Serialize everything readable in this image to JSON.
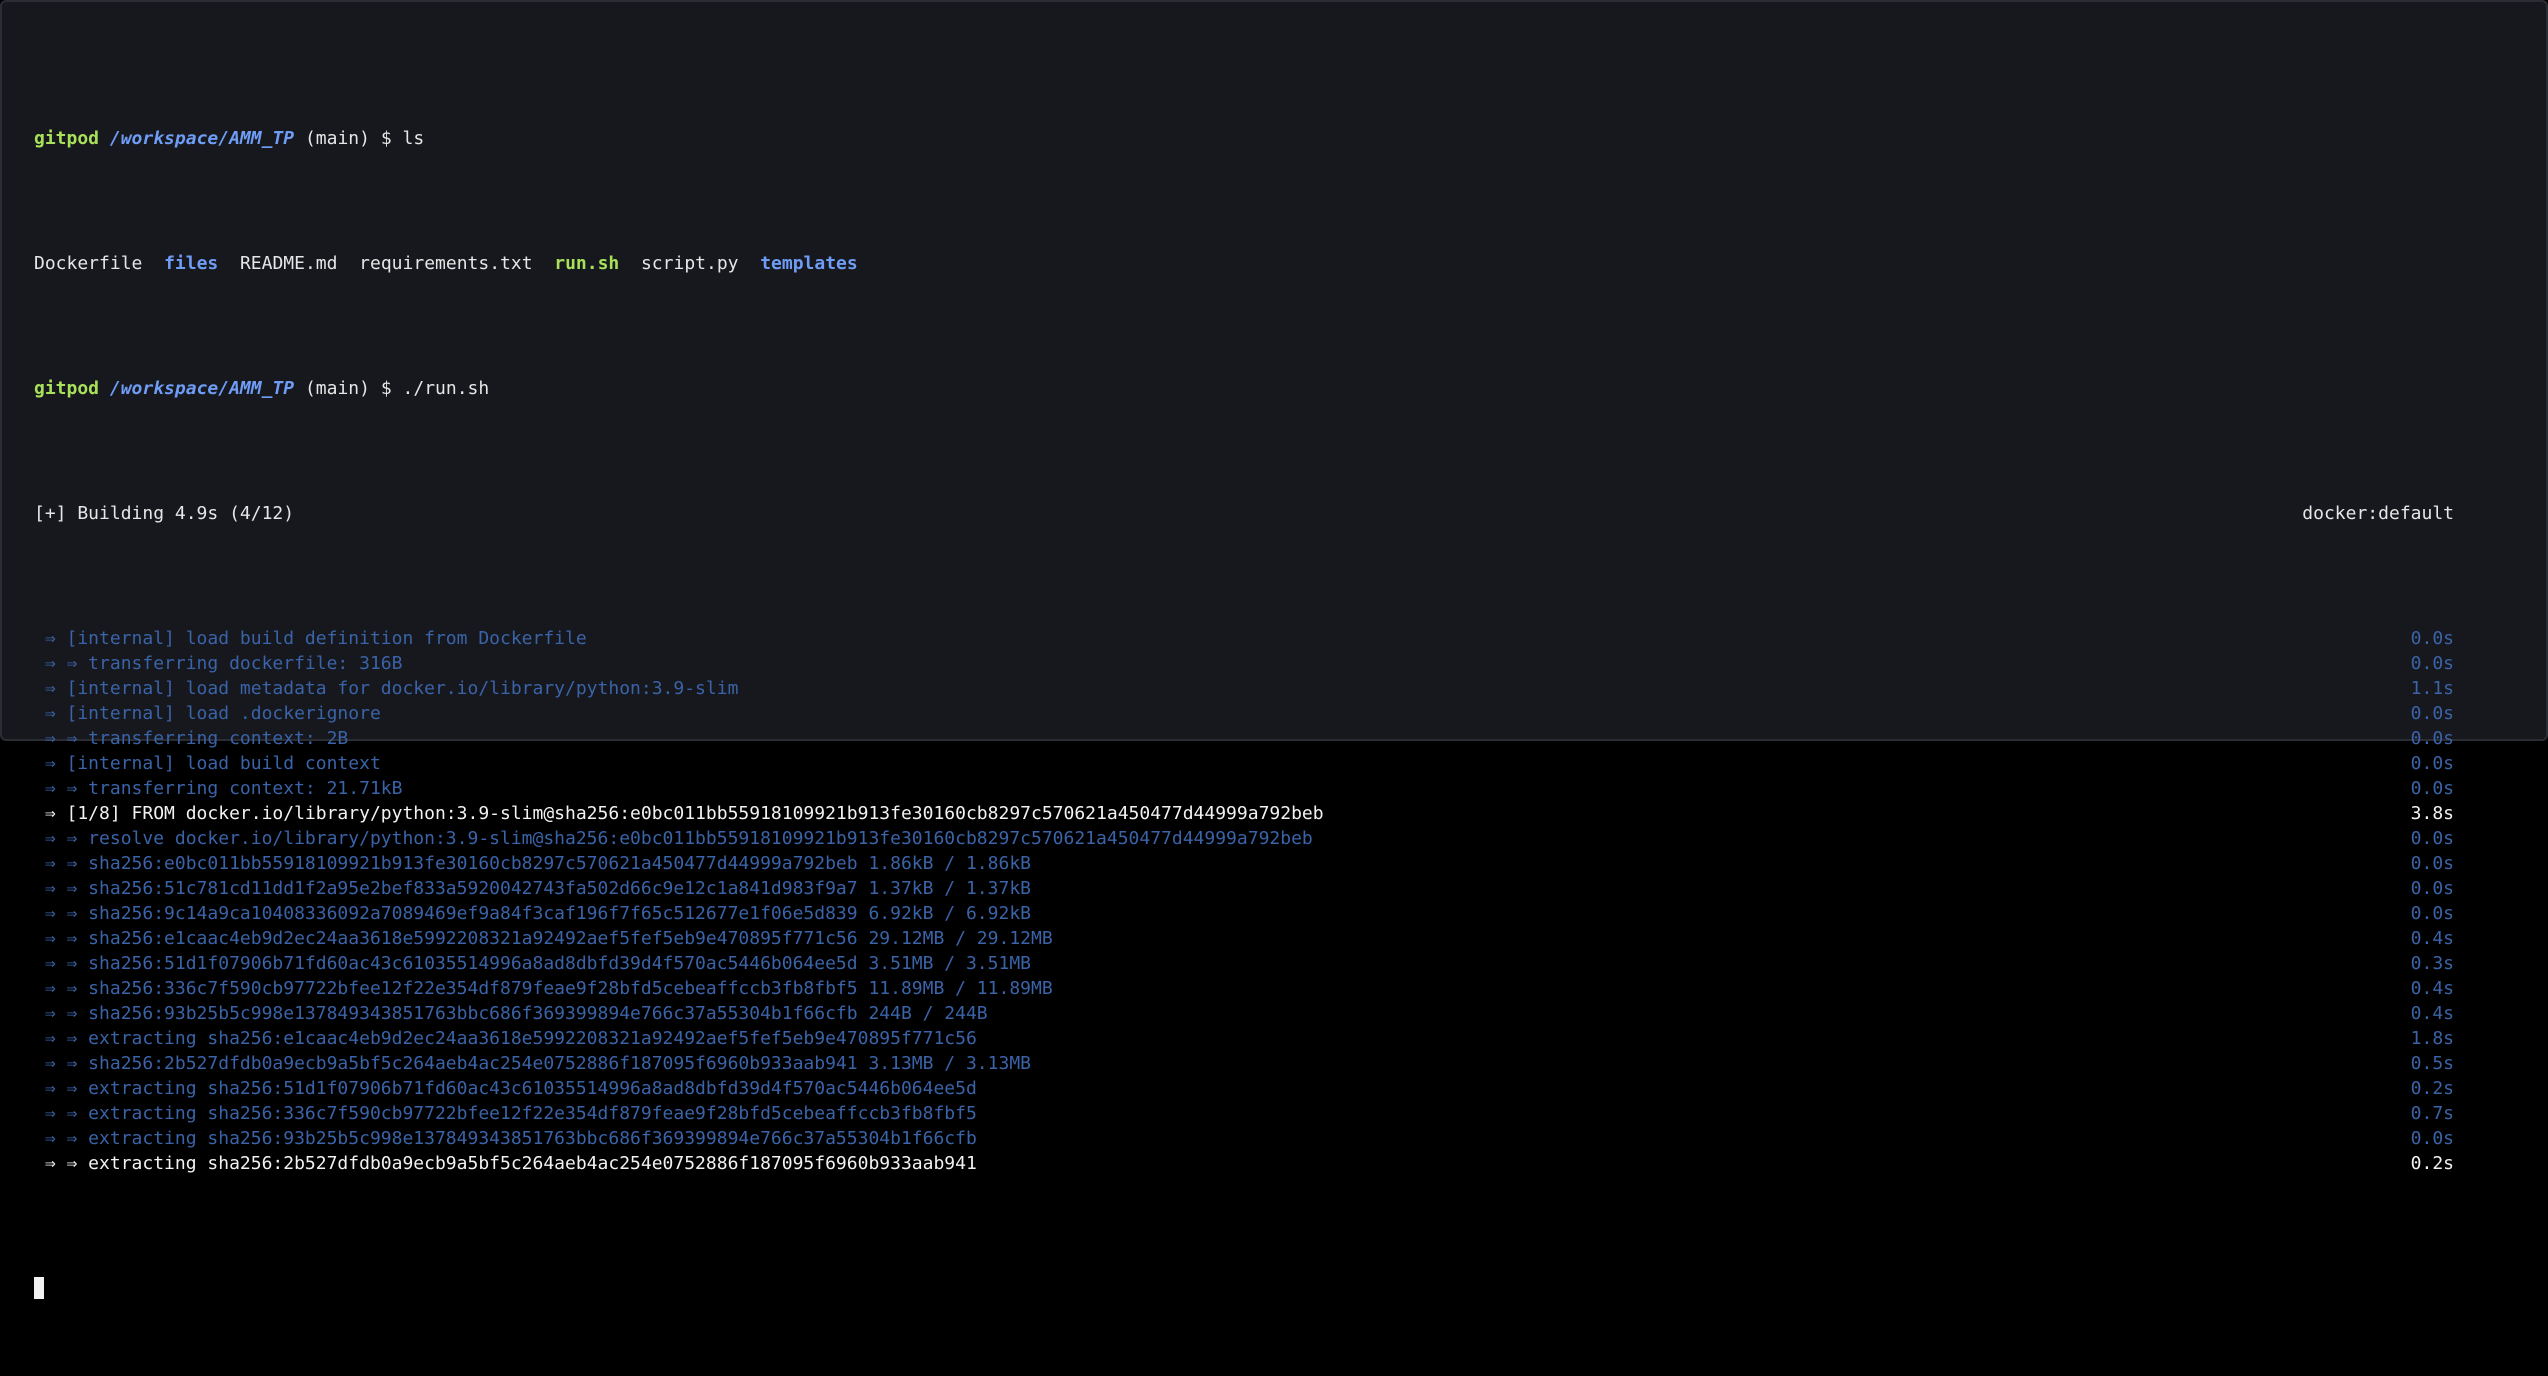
{
  "prompt": {
    "user": "gitpod",
    "path": "/workspace/AMM_TP",
    "branch": "(main)",
    "symbol": "$"
  },
  "commands": {
    "first": "ls",
    "second": "./run.sh"
  },
  "ls_output": [
    {
      "name": "Dockerfile",
      "kind": "file"
    },
    {
      "name": "files",
      "kind": "dir"
    },
    {
      "name": "README.md",
      "kind": "file"
    },
    {
      "name": "requirements.txt",
      "kind": "file"
    },
    {
      "name": "run.sh",
      "kind": "exe"
    },
    {
      "name": "script.py",
      "kind": "file"
    },
    {
      "name": "templates",
      "kind": "dir"
    }
  ],
  "build": {
    "header": "[+] Building 4.9s (4/12)",
    "context": "docker:default"
  },
  "steps": [
    {
      "text": " ⇒ [internal] load build definition from Dockerfile",
      "time": "0.0s",
      "style": "dim"
    },
    {
      "text": " ⇒ ⇒ transferring dockerfile: 316B",
      "time": "0.0s",
      "style": "dim"
    },
    {
      "text": " ⇒ [internal] load metadata for docker.io/library/python:3.9-slim",
      "time": "1.1s",
      "style": "dim"
    },
    {
      "text": " ⇒ [internal] load .dockerignore",
      "time": "0.0s",
      "style": "dim"
    },
    {
      "text": " ⇒ ⇒ transferring context: 2B",
      "time": "0.0s",
      "style": "dim"
    },
    {
      "text": " ⇒ [internal] load build context",
      "time": "0.0s",
      "style": "dim"
    },
    {
      "text": " ⇒ ⇒ transferring context: 21.71kB",
      "time": "0.0s",
      "style": "dim"
    },
    {
      "text": " ⇒ [1/8] FROM docker.io/library/python:3.9-slim@sha256:e0bc011bb55918109921b913fe30160cb8297c570621a450477d44999a792beb",
      "time": "3.8s",
      "style": "bright"
    },
    {
      "text": " ⇒ ⇒ resolve docker.io/library/python:3.9-slim@sha256:e0bc011bb55918109921b913fe30160cb8297c570621a450477d44999a792beb",
      "time": "0.0s",
      "style": "dim"
    },
    {
      "text": " ⇒ ⇒ sha256:e0bc011bb55918109921b913fe30160cb8297c570621a450477d44999a792beb 1.86kB / 1.86kB",
      "time": "0.0s",
      "style": "dim"
    },
    {
      "text": " ⇒ ⇒ sha256:51c781cd11dd1f2a95e2bef833a5920042743fa502d66c9e12c1a841d983f9a7 1.37kB / 1.37kB",
      "time": "0.0s",
      "style": "dim"
    },
    {
      "text": " ⇒ ⇒ sha256:9c14a9ca10408336092a7089469ef9a84f3caf196f7f65c512677e1f06e5d839 6.92kB / 6.92kB",
      "time": "0.0s",
      "style": "dim"
    },
    {
      "text": " ⇒ ⇒ sha256:e1caac4eb9d2ec24aa3618e5992208321a92492aef5fef5eb9e470895f771c56 29.12MB / 29.12MB",
      "time": "0.4s",
      "style": "dim"
    },
    {
      "text": " ⇒ ⇒ sha256:51d1f07906b71fd60ac43c61035514996a8ad8dbfd39d4f570ac5446b064ee5d 3.51MB / 3.51MB",
      "time": "0.3s",
      "style": "dim"
    },
    {
      "text": " ⇒ ⇒ sha256:336c7f590cb97722bfee12f22e354df879feae9f28bfd5cebeaffccb3fb8fbf5 11.89MB / 11.89MB",
      "time": "0.4s",
      "style": "dim"
    },
    {
      "text": " ⇒ ⇒ sha256:93b25b5c998e137849343851763bbc686f369399894e766c37a55304b1f66cfb 244B / 244B",
      "time": "0.4s",
      "style": "dim"
    },
    {
      "text": " ⇒ ⇒ extracting sha256:e1caac4eb9d2ec24aa3618e5992208321a92492aef5fef5eb9e470895f771c56",
      "time": "1.8s",
      "style": "dim"
    },
    {
      "text": " ⇒ ⇒ sha256:2b527dfdb0a9ecb9a5bf5c264aeb4ac254e0752886f187095f6960b933aab941 3.13MB / 3.13MB",
      "time": "0.5s",
      "style": "dim"
    },
    {
      "text": " ⇒ ⇒ extracting sha256:51d1f07906b71fd60ac43c61035514996a8ad8dbfd39d4f570ac5446b064ee5d",
      "time": "0.2s",
      "style": "dim"
    },
    {
      "text": " ⇒ ⇒ extracting sha256:336c7f590cb97722bfee12f22e354df879feae9f28bfd5cebeaffccb3fb8fbf5",
      "time": "0.7s",
      "style": "dim"
    },
    {
      "text": " ⇒ ⇒ extracting sha256:93b25b5c998e137849343851763bbc686f369399894e766c37a55304b1f66cfb",
      "time": "0.0s",
      "style": "dim"
    },
    {
      "text": " ⇒ ⇒ extracting sha256:2b527dfdb0a9ecb9a5bf5c264aeb4ac254e0752886f187095f6960b933aab941",
      "time": "0.2s",
      "style": "bright"
    }
  ],
  "colors": {
    "background": "#16181d",
    "prompt_user": "#a8e05a",
    "prompt_path": "#6f9cf5",
    "dim_step": "#3a63a8",
    "bright_step": "#f2f2f2"
  }
}
